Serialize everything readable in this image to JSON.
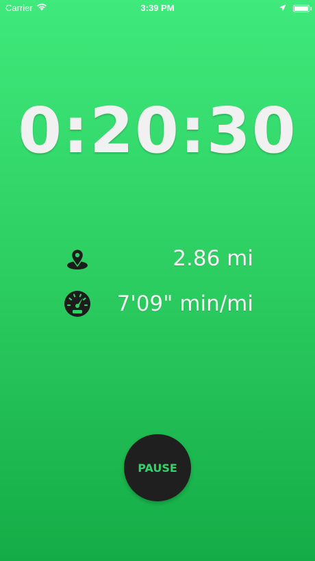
{
  "status_bar": {
    "carrier": "Carrier",
    "time": "3:39 PM",
    "battery_level": 1.0,
    "icons": [
      "wifi-icon",
      "location-arrow-icon",
      "battery-icon"
    ]
  },
  "timer": {
    "elapsed": "0:20:30"
  },
  "stats": {
    "distance": {
      "icon": "map-pin-icon",
      "value": "2.86 mi"
    },
    "pace": {
      "icon": "speedometer-icon",
      "value": "7'09\" min/mi"
    }
  },
  "controls": {
    "pause_label": "PAUSE"
  },
  "colors": {
    "background_top": "#3fe97b",
    "background_bottom": "#14ac46",
    "button_bg": "#1f1f1f",
    "button_text": "#2fd36a",
    "text": "#f1f1f1",
    "icon": "#1c1c1c"
  }
}
